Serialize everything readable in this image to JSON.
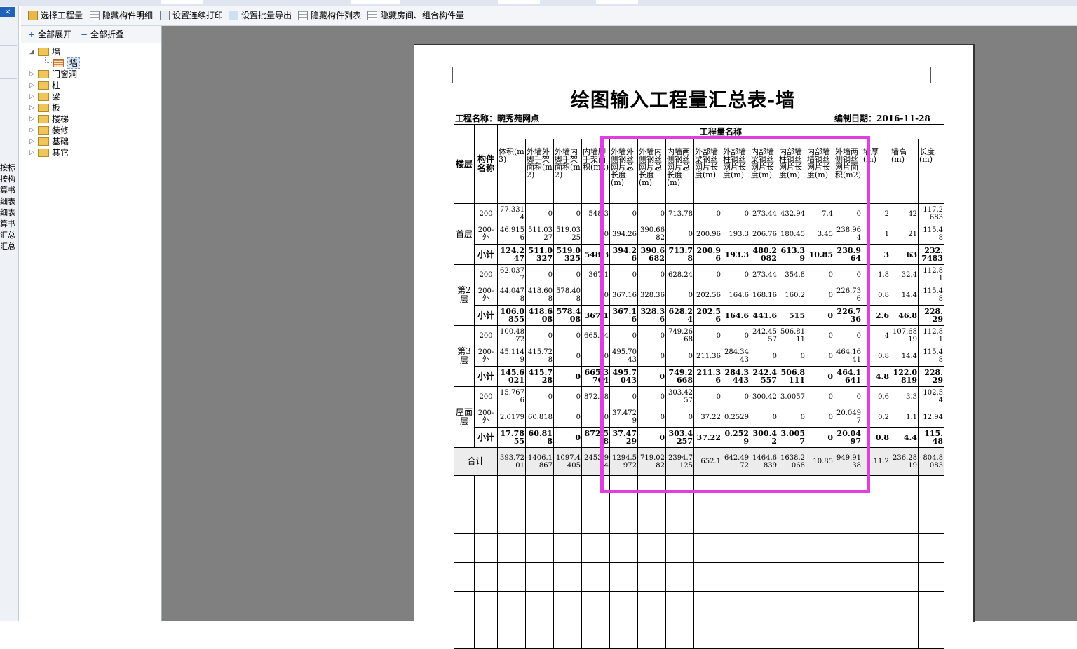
{
  "left_strip": {
    "close_glyph": "×",
    "labels": [
      "按标",
      "按构",
      "算书",
      "细表",
      "细表",
      "算书",
      "汇总",
      "汇总"
    ]
  },
  "toolbar": {
    "items": [
      {
        "label": "选择工程量",
        "icon": "folder-icon"
      },
      {
        "label": "隐藏构件明细",
        "icon": "grid-icon"
      },
      {
        "label": "设置连续打印",
        "icon": "print-icon"
      },
      {
        "label": "设置批量导出",
        "icon": "export-icon"
      },
      {
        "label": "隐藏构件列表",
        "icon": "grid-icon"
      },
      {
        "label": "隐藏房间、组合构件量",
        "icon": "grid-icon"
      }
    ]
  },
  "panel": {
    "expand_all": "全部展开",
    "collapse_all": "全部折叠",
    "expand_sym": "+",
    "collapse_sym": "−"
  },
  "tree": {
    "root": "墙",
    "child": "墙",
    "others": [
      "门窗洞",
      "柱",
      "梁",
      "板",
      "楼梯",
      "装修",
      "基础",
      "其它"
    ]
  },
  "report": {
    "title": "绘图输入工程量汇总表-墙",
    "project_label": "工程名称：",
    "project_name": "畹秀苑网点",
    "date_label": "编制日期：",
    "date": "2016-11-28",
    "group_header": "工程量名称",
    "col_floor": "楼层",
    "col_name": "构件名称",
    "columns": [
      "体积(m3)",
      "外墙外脚手架面积(m2)",
      "外墙内脚手架面积(m2)",
      "内墙脚手架面积(m2)",
      "外墙外侧钢丝网片总长度(m)",
      "外墙内侧钢丝网片总长度(m)",
      "内墙两侧钢丝网片总长度(m)",
      "外部墙梁钢丝网片长度(m)",
      "外部墙柱钢丝网片长度(m)",
      "内部墙梁钢丝网片长度(m)",
      "内部墙柱钢丝网片长度(m)",
      "内部墙墙钢丝网片长度(m)",
      "外墙两侧钢丝网片面积(m2)",
      "墙厚(m)",
      "墙高(m)",
      "长度(m)"
    ],
    "floors": [
      {
        "name": "首层",
        "rows": [
          {
            "name": "200",
            "vals": [
              "77.3314",
              "0",
              "0",
              "548.3",
              "0",
              "0",
              "713.78",
              "0",
              "0",
              "273.44",
              "432.94",
              "7.4",
              "0",
              "2",
              "42",
              "117.2683"
            ]
          },
          {
            "name": "200-外",
            "vals": [
              "46.9156",
              "511.0327",
              "519.0325",
              "0",
              "394.26",
              "390.6682",
              "0",
              "200.96",
              "193.3",
              "206.76",
              "180.45",
              "3.45",
              "238.964",
              "1",
              "21",
              "115.48"
            ]
          },
          {
            "name": "小计",
            "vals": [
              "124.247",
              "511.0327",
              "519.0325",
              "548.3",
              "394.26",
              "390.6682",
              "713.78",
              "200.96",
              "193.3",
              "480.2082",
              "613.39",
              "10.85",
              "238.964",
              "3",
              "63",
              "232.7483"
            ]
          }
        ]
      },
      {
        "name": "第2层",
        "rows": [
          {
            "name": "200",
            "vals": [
              "62.0377",
              "0",
              "0",
              "367.1",
              "0",
              "0",
              "628.24",
              "0",
              "0",
              "273.44",
              "354.8",
              "0",
              "0",
              "1.8",
              "32.4",
              "112.81"
            ]
          },
          {
            "name": "200-外",
            "vals": [
              "44.0478",
              "418.608",
              "578.408",
              "0",
              "367.16",
              "328.36",
              "0",
              "202.56",
              "164.6",
              "168.16",
              "160.2",
              "0",
              "226.736",
              "0.8",
              "14.4",
              "115.48"
            ]
          },
          {
            "name": "小计",
            "vals": [
              "106.0855",
              "418.608",
              "578.408",
              "367.1",
              "367.16",
              "328.36",
              "628.24",
              "202.56",
              "164.6",
              "441.6",
              "515",
              "0",
              "226.736",
              "2.6",
              "46.8",
              "228.29"
            ]
          }
        ]
      },
      {
        "name": "第3层",
        "rows": [
          {
            "name": "200",
            "vals": [
              "100.4872",
              "0",
              "0",
              "665.74",
              "0",
              "0",
              "749.2668",
              "0",
              "0",
              "242.4557",
              "506.8111",
              "0",
              "0",
              "4",
              "107.6819",
              "112.81"
            ]
          },
          {
            "name": "200-外",
            "vals": [
              "45.1149",
              "415.728",
              "0",
              "0",
              "495.7043",
              "0",
              "0",
              "211.36",
              "284.3443",
              "0",
              "0",
              "0",
              "464.1641",
              "0.8",
              "14.4",
              "115.48"
            ]
          },
          {
            "name": "小计",
            "vals": [
              "145.6021",
              "415.728",
              "0",
              "665.3704",
              "495.7043",
              "0",
              "749.2668",
              "211.36",
              "284.3443",
              "242.4557",
              "506.8111",
              "0",
              "464.1641",
              "4.8",
              "122.0819",
              "228.29"
            ]
          }
        ]
      },
      {
        "name": "屋面层",
        "rows": [
          {
            "name": "200",
            "vals": [
              "15.7676",
              "0",
              "0",
              "872.58",
              "0",
              "0",
              "303.4257",
              "0",
              "0",
              "300.42",
              "3.0057",
              "0",
              "0",
              "0.6",
              "3.3",
              "102.54"
            ]
          },
          {
            "name": "200-外",
            "vals": [
              "2.0179",
              "60.818",
              "0",
              "0",
              "37.4729",
              "0",
              "0",
              "37.22",
              "0.2529",
              "0",
              "0",
              "0",
              "20.0497",
              "0.2",
              "1.1",
              "12.94"
            ]
          },
          {
            "name": "小计",
            "vals": [
              "17.7855",
              "60.818",
              "0",
              "872.58",
              "37.4729",
              "0",
              "303.4257",
              "37.22",
              "0.2529",
              "300.42",
              "3.0057",
              "0",
              "20.0497",
              "0.8",
              "4.4",
              "115.48"
            ]
          }
        ]
      }
    ],
    "total_label": "合计",
    "total_vals": [
      "393.7201",
      "1406.1867",
      "1097.4405",
      "2453.94",
      "1294.5972",
      "719.0282",
      "2394.7125",
      "652.1",
      "642.4972",
      "1464.6839",
      "1638.2068",
      "10.85",
      "949.9138",
      "11.2",
      "236.2819",
      "804.8083"
    ],
    "highlight_color": "#e03ee0"
  }
}
